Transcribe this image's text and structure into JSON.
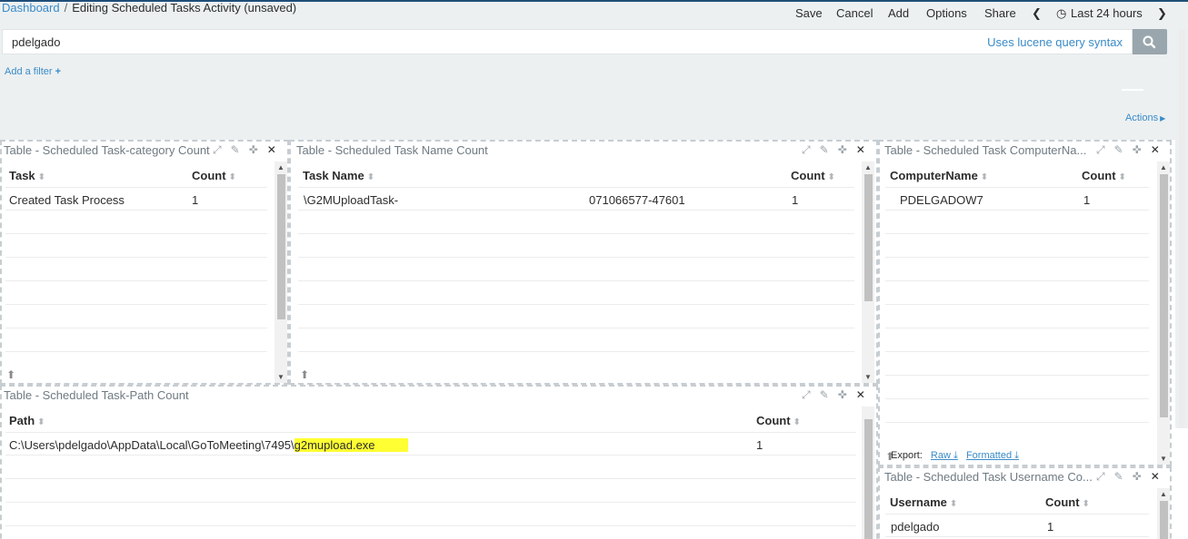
{
  "breadcrumb": {
    "parent": "Dashboard",
    "separator": "/",
    "current": "Editing Scheduled Tasks Activity (unsaved)"
  },
  "menu": {
    "save": "Save",
    "cancel": "Cancel",
    "add": "Add",
    "options": "Options",
    "share": "Share",
    "time_range": "Last 24 hours"
  },
  "query": {
    "value": "pdelgado",
    "hint": "Uses lucene query syntax"
  },
  "filters": {
    "add_filter": "Add a filter"
  },
  "actions_label": "Actions",
  "panels": {
    "category": {
      "title": "Table - Scheduled Task-category Count",
      "columns": [
        "Task",
        "Count"
      ],
      "rows": [
        [
          "Created Task Process",
          "1"
        ]
      ]
    },
    "taskname": {
      "title": "Table - Scheduled Task Name Count",
      "columns": [
        "Task Name",
        "Count"
      ],
      "rows": [
        [
          "\\G2MUploadTask-",
          "071066577-47601",
          "1"
        ]
      ]
    },
    "computer": {
      "title": "Table - Scheduled Task ComputerNa...",
      "columns": [
        "ComputerName",
        "Count"
      ],
      "rows": [
        [
          "PDELGADOW7",
          "1"
        ]
      ],
      "export": {
        "label": "Export:",
        "raw": "Raw",
        "formatted": "Formatted"
      }
    },
    "path": {
      "title": "Table - Scheduled Task-Path Count",
      "columns": [
        "Path",
        "Count"
      ],
      "rows": [
        [
          "C:\\Users\\pdelgado\\AppData\\Local\\GoToMeeting\\7495\\",
          "g2mupload.exe",
          "1"
        ]
      ]
    },
    "username": {
      "title": "Table - Scheduled Task Username Co...",
      "columns": [
        "Username",
        "Count"
      ],
      "rows": [
        [
          "pdelgado",
          "1"
        ]
      ]
    }
  },
  "colors": {
    "accent": "#3a8bc8",
    "highlight": "#ffff33",
    "topbar_bg": "#ecf0f1"
  }
}
